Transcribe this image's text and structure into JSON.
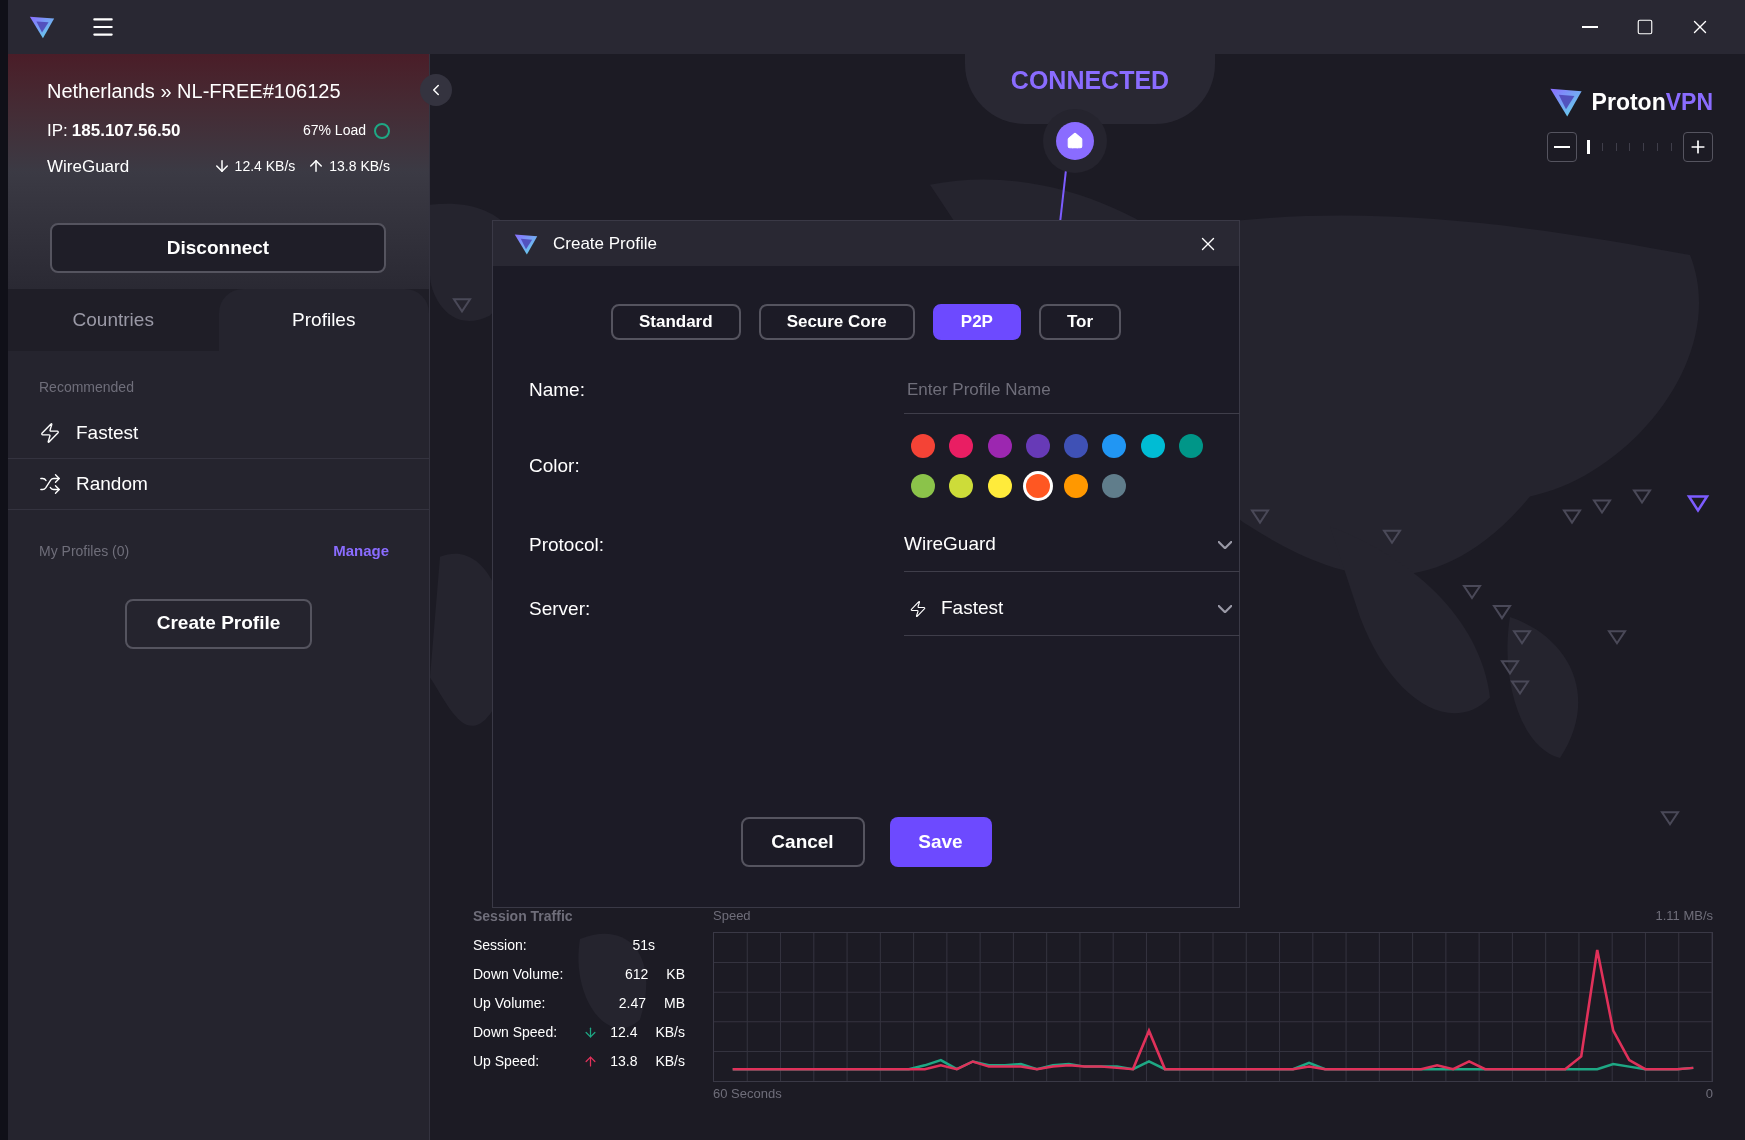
{
  "connection": {
    "server": "Netherlands » NL-FREE#106125",
    "ip_label": "IP:",
    "ip": "185.107.56.50",
    "load": "67% Load",
    "protocol": "WireGuard",
    "down": "12.4 KB/s",
    "up": "13.8 KB/s"
  },
  "disconnect_button": "Disconnect",
  "sidebar_tabs": [
    {
      "label": "Countries",
      "selected": false
    },
    {
      "label": "Profiles",
      "selected": true
    }
  ],
  "recommended": {
    "heading": "Recommended",
    "items": [
      {
        "kind": "fastest",
        "label": "Fastest"
      },
      {
        "kind": "random",
        "label": "Random"
      }
    ]
  },
  "my_profiles": {
    "heading": "My Profiles (0)",
    "manage": "Manage",
    "create_button": "Create Profile"
  },
  "status": {
    "label": "CONNECTED"
  },
  "logo": {
    "name": "Proton",
    "suffix": "VPN"
  },
  "zoom": {
    "level": 0
  },
  "dialog": {
    "title": "Create Profile",
    "profile_types": [
      {
        "label": "Standard",
        "selected": false
      },
      {
        "label": "Secure Core",
        "selected": false
      },
      {
        "label": "P2P",
        "selected": true
      },
      {
        "label": "Tor",
        "selected": false
      }
    ],
    "name": {
      "label": "Name:",
      "placeholder": "Enter Profile Name"
    },
    "color": {
      "label": "Color:",
      "options": [
        {
          "color": "#f44336",
          "selected": false
        },
        {
          "color": "#e91e63",
          "selected": false
        },
        {
          "color": "#9c27b0",
          "selected": false
        },
        {
          "color": "#673ab7",
          "selected": false
        },
        {
          "color": "#3f51b5",
          "selected": false
        },
        {
          "color": "#2196f3",
          "selected": false
        },
        {
          "color": "#00bcd4",
          "selected": false
        },
        {
          "color": "#009688",
          "selected": false
        },
        {
          "color": "#8bc34a",
          "selected": false
        },
        {
          "color": "#cddc39",
          "selected": false
        },
        {
          "color": "#ffeb3b",
          "selected": false
        },
        {
          "color": "#ff5722",
          "selected": true
        },
        {
          "color": "#ff9800",
          "selected": false
        },
        {
          "color": "#607d8b",
          "selected": false
        }
      ]
    },
    "protocol": {
      "label": "Protocol:",
      "value": "WireGuard"
    },
    "server": {
      "label": "Server:",
      "value": "Fastest"
    },
    "buttons": [
      {
        "kind": "secondary",
        "label": "Cancel"
      },
      {
        "kind": "primary",
        "label": "Save"
      }
    ]
  },
  "session_traffic": {
    "title": "Session Traffic",
    "rows": [
      {
        "kind": "plain",
        "label": "Session:",
        "value": "51s"
      },
      {
        "kind": "plain",
        "label": "Down Volume:",
        "value": "612",
        "unit": "KB"
      },
      {
        "kind": "plain",
        "label": "Up Volume:",
        "value": "2.47",
        "unit": "MB"
      },
      {
        "kind": "down",
        "label": "Down Speed:",
        "value": "12.4",
        "unit": "KB/s"
      },
      {
        "kind": "up",
        "label": "Up Speed:",
        "value": "13.8",
        "unit": "KB/s"
      }
    ],
    "chart": {
      "title": "Speed",
      "max": "1.11 MB/s",
      "x_start": "60 Seconds",
      "x_end": "0"
    }
  }
}
